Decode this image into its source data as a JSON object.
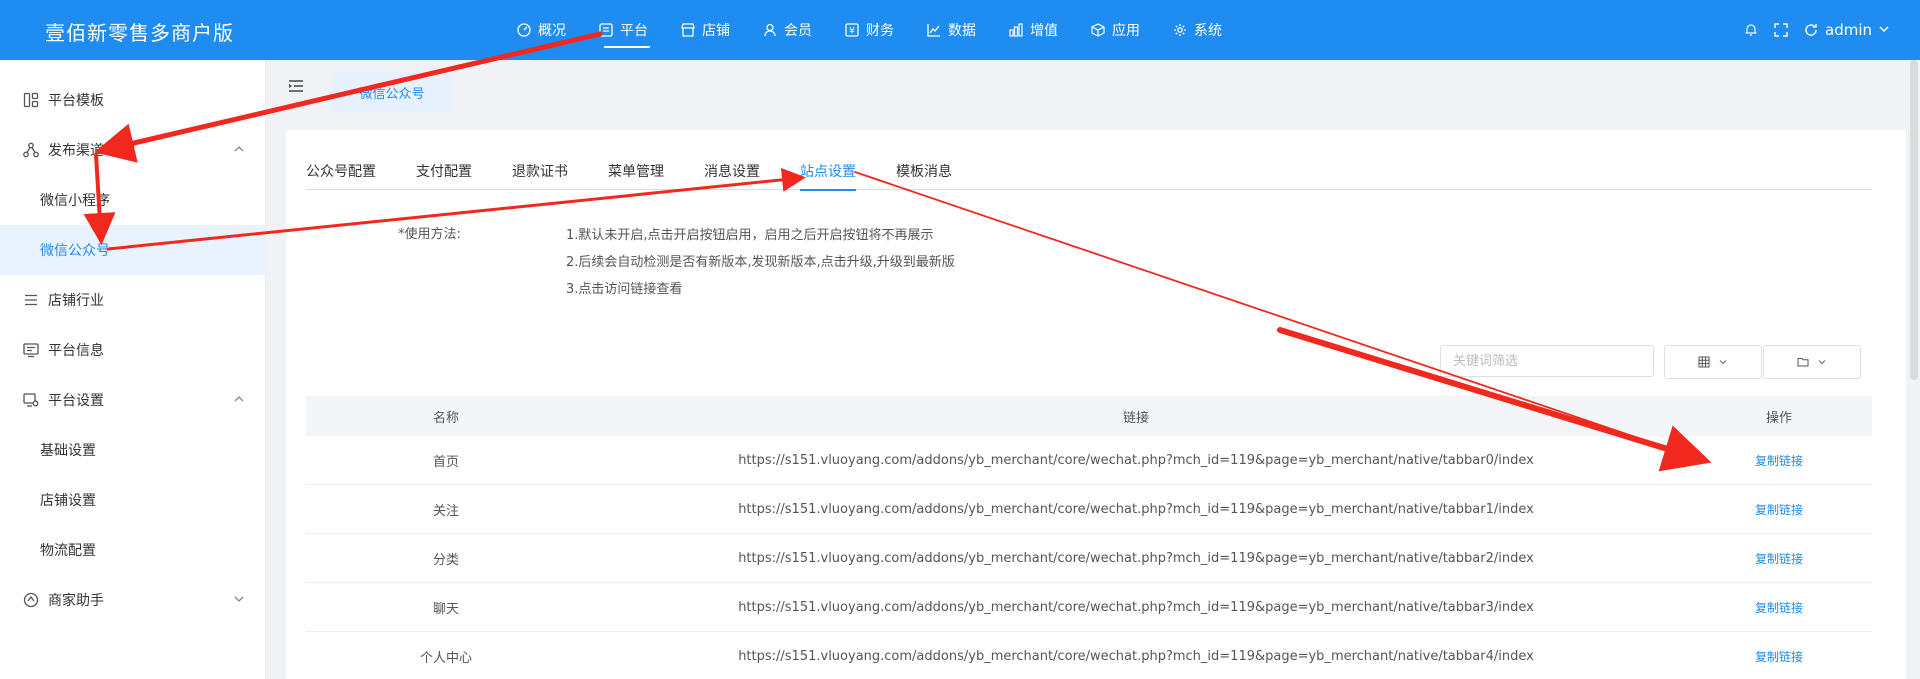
{
  "header": {
    "logo": "壹佰新零售多商户版",
    "nav": [
      {
        "label": "概况",
        "icon": "dashboard-icon"
      },
      {
        "label": "平台",
        "icon": "platform-icon",
        "active": true
      },
      {
        "label": "店铺",
        "icon": "store-icon"
      },
      {
        "label": "会员",
        "icon": "user-icon"
      },
      {
        "label": "财务",
        "icon": "finance-icon"
      },
      {
        "label": "数据",
        "icon": "chart-line-icon"
      },
      {
        "label": "增值",
        "icon": "bar-chart-icon"
      },
      {
        "label": "应用",
        "icon": "cube-icon"
      },
      {
        "label": "系统",
        "icon": "gear-icon"
      }
    ],
    "user": "admin"
  },
  "sidebar": {
    "items": [
      {
        "label": "平台模板",
        "icon": "template-icon"
      },
      {
        "label": "发布渠道",
        "icon": "channel-icon",
        "expanded": true
      },
      {
        "label": "微信小程序",
        "sub": true
      },
      {
        "label": "微信公众号",
        "sub": true,
        "active": true
      },
      {
        "label": "店铺行业",
        "icon": "list-icon"
      },
      {
        "label": "平台信息",
        "icon": "monitor-icon"
      },
      {
        "label": "平台设置",
        "icon": "settings-monitor-icon",
        "expanded": true
      },
      {
        "label": "基础设置",
        "sub": true
      },
      {
        "label": "店铺设置",
        "sub": true
      },
      {
        "label": "物流配置",
        "sub": true
      },
      {
        "label": "商家助手",
        "icon": "helper-icon",
        "expanded": false
      }
    ]
  },
  "page_tab": "微信公众号",
  "tabs": [
    "公众号配置",
    "支付配置",
    "退款证书",
    "菜单管理",
    "消息设置",
    "站点设置",
    "模板消息"
  ],
  "active_tab": "站点设置",
  "usage": {
    "label": "*使用方法:",
    "lines": [
      "1.默认未开启,点击开启按钮启用，启用之后开启按钮将不再展示",
      "2.后续会自动检测是否有新版本,发现新版本,点击升级,升级到最新版",
      "3.点击访问链接查看"
    ]
  },
  "search": {
    "placeholder": "关键词筛选"
  },
  "table": {
    "headers": [
      "名称",
      "链接",
      "操作"
    ],
    "rows": [
      {
        "name": "首页",
        "link": "https://s151.vluoyang.com/addons/yb_merchant/core/wechat.php?mch_id=119&page=yb_merchant/native/tabbar0/index",
        "action": "复制链接"
      },
      {
        "name": "关注",
        "link": "https://s151.vluoyang.com/addons/yb_merchant/core/wechat.php?mch_id=119&page=yb_merchant/native/tabbar1/index",
        "action": "复制链接"
      },
      {
        "name": "分类",
        "link": "https://s151.vluoyang.com/addons/yb_merchant/core/wechat.php?mch_id=119&page=yb_merchant/native/tabbar2/index",
        "action": "复制链接"
      },
      {
        "name": "聊天",
        "link": "https://s151.vluoyang.com/addons/yb_merchant/core/wechat.php?mch_id=119&page=yb_merchant/native/tabbar3/index",
        "action": "复制链接"
      },
      {
        "name": "个人中心",
        "link": "https://s151.vluoyang.com/addons/yb_merchant/core/wechat.php?mch_id=119&page=yb_merchant/native/tabbar4/index",
        "action": "复制链接"
      }
    ]
  },
  "colors": {
    "primary": "#1e8cf0",
    "annotation": "#f0281e"
  }
}
